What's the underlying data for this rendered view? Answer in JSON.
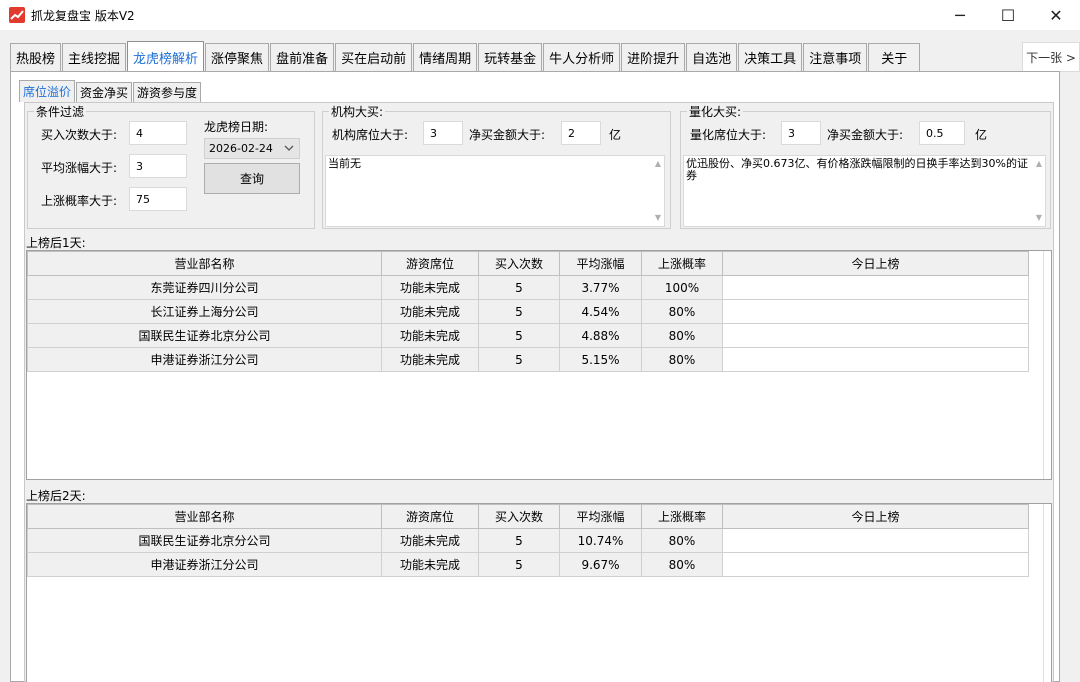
{
  "window": {
    "title": "抓龙复盘宝  版本V2",
    "controls": [
      "─",
      "☐",
      "✕"
    ]
  },
  "main_tabs": [
    {
      "label": "热股榜"
    },
    {
      "label": "主线挖掘"
    },
    {
      "label": "龙虎榜解析",
      "active": true
    },
    {
      "label": "涨停聚焦"
    },
    {
      "label": "盘前准备"
    },
    {
      "label": "买在启动前"
    },
    {
      "label": "情绪周期"
    },
    {
      "label": "玩转基金"
    },
    {
      "label": "牛人分析师"
    },
    {
      "label": "进阶提升"
    },
    {
      "label": "自选池"
    },
    {
      "label": "决策工具"
    },
    {
      "label": "注意事项"
    },
    {
      "label": "关于"
    }
  ],
  "next_button": "下一张 >",
  "sub_tabs": [
    {
      "label": "席位溢价",
      "active": true
    },
    {
      "label": "资金净买"
    },
    {
      "label": "游资参与度"
    }
  ],
  "filter": {
    "title": "条件过滤",
    "buy_count_label": "买入次数大于:",
    "buy_count": "4",
    "avg_gain_label": "平均涨幅大于:",
    "avg_gain": "3",
    "rise_prob_label": "上涨概率大于:",
    "rise_prob": "75",
    "date_label": "龙虎榜日期:",
    "date": "2026-02-24",
    "query_label": "查询"
  },
  "institution": {
    "title": "机构大买:",
    "seats_label": "机构席位大于:",
    "seats": "3",
    "net_buy_label": "净买金额大于:",
    "net_buy": "2",
    "unit": "亿",
    "memo": "当前无"
  },
  "quant": {
    "title": "量化大买:",
    "seats_label": "量化席位大于:",
    "seats": "3",
    "net_buy_label": "净买金额大于:",
    "net_buy": "0.5",
    "unit": "亿",
    "memo": "优迅股份、净买0.673亿、有价格涨跌幅限制的日换手率达到30%的证券"
  },
  "columns": [
    "营业部名称",
    "游资席位",
    "买入次数",
    "平均涨幅",
    "上涨概率",
    "今日上榜"
  ],
  "day1": {
    "label": "上榜后1天:",
    "rows": [
      [
        "东莞证券四川分公司",
        "功能未完成",
        "5",
        "3.77%",
        "100%",
        ""
      ],
      [
        "长江证券上海分公司",
        "功能未完成",
        "5",
        "4.54%",
        "80%",
        ""
      ],
      [
        "国联民生证券北京分公司",
        "功能未完成",
        "5",
        "4.88%",
        "80%",
        ""
      ],
      [
        "申港证券浙江分公司",
        "功能未完成",
        "5",
        "5.15%",
        "80%",
        ""
      ]
    ]
  },
  "day2": {
    "label": "上榜后2天:",
    "rows": [
      [
        "国联民生证券北京分公司",
        "功能未完成",
        "5",
        "10.74%",
        "80%",
        ""
      ],
      [
        "申港证券浙江分公司",
        "功能未完成",
        "5",
        "9.67%",
        "80%",
        ""
      ]
    ]
  }
}
